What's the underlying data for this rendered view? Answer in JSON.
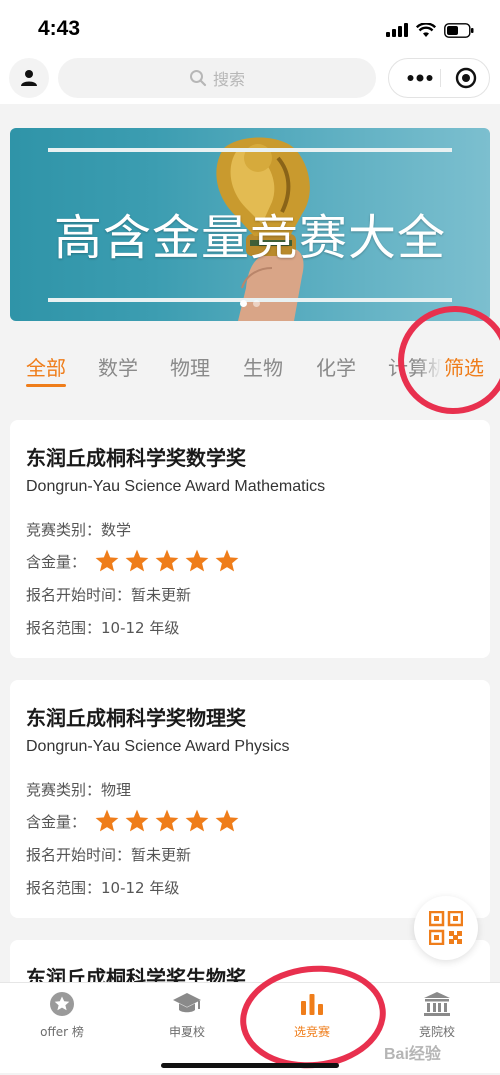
{
  "status_bar": {
    "time": "4:43"
  },
  "nav": {
    "search_placeholder": "搜索"
  },
  "banner": {
    "title": "高含金量竞赛大全"
  },
  "tabs": {
    "items": [
      "全部",
      "数学",
      "物理",
      "生物",
      "化学",
      "计算机"
    ],
    "active_index": 0,
    "filter_label": "筛选"
  },
  "cards": [
    {
      "title": "东润丘成桐科学奖数学奖",
      "subtitle": "Dongrun-Yau Science Award Mathematics",
      "category_label": "竞赛类别：",
      "category": "数学",
      "rating_label": "含金量：",
      "rating": 5,
      "signup_label": "报名开始时间：",
      "signup": "暂未更新",
      "range_label": "报名范围：",
      "range": "10-12 年级"
    },
    {
      "title": "东润丘成桐科学奖物理奖",
      "subtitle": "Dongrun-Yau Science Award Physics",
      "category_label": "竞赛类别：",
      "category": "物理",
      "rating_label": "含金量：",
      "rating": 5,
      "signup_label": "报名开始时间：",
      "signup": "暂未更新",
      "range_label": "报名范围：",
      "range": "10-12 年级"
    },
    {
      "title": "东润丘成桐科学奖生物奖"
    }
  ],
  "tab_bar": {
    "items": [
      {
        "label": "offer 榜",
        "icon": "star-badge-icon"
      },
      {
        "label": "申夏校",
        "icon": "graduation-cap-icon"
      },
      {
        "label": "选竞赛",
        "icon": "bar-chart-icon"
      },
      {
        "label": "竞院校",
        "icon": "school-building-icon"
      }
    ],
    "active_index": 2
  },
  "watermark": "Bai经验",
  "colors": {
    "accent": "#ef7d1a",
    "annotation_ring": "#e8304e",
    "banner": "#3c9db1"
  }
}
